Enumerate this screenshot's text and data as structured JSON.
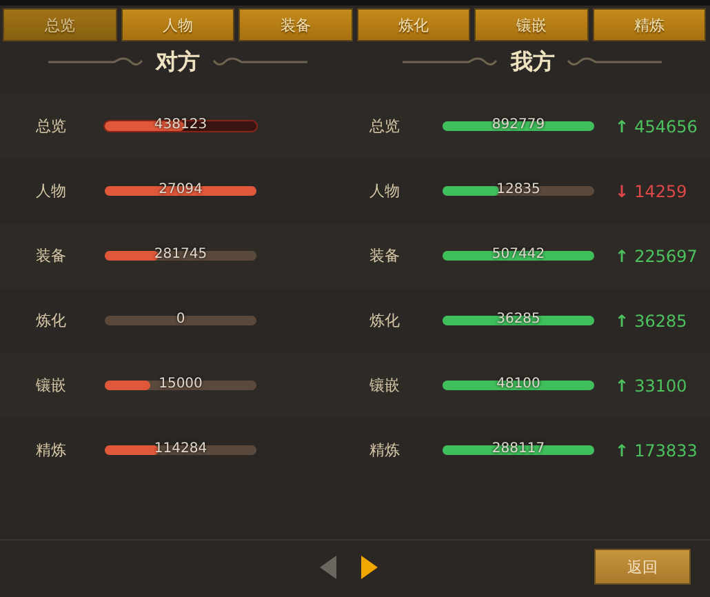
{
  "tabs": [
    {
      "label": "总览",
      "selected": true
    },
    {
      "label": "人物",
      "selected": false
    },
    {
      "label": "装备",
      "selected": false
    },
    {
      "label": "炼化",
      "selected": false
    },
    {
      "label": "镶嵌",
      "selected": false
    },
    {
      "label": "精炼",
      "selected": false
    }
  ],
  "sides": [
    {
      "title": "对方"
    },
    {
      "title": "我方"
    }
  ],
  "rows": [
    {
      "opponent": {
        "label": "总览",
        "value": "438123",
        "level": 0.53,
        "outlined": true
      },
      "mine": {
        "label": "总览",
        "value": "892779",
        "level": 1.0
      },
      "change": {
        "arrow": "↑",
        "value": "454656",
        "color": "#4cc25e"
      }
    },
    {
      "opponent": {
        "label": "人物",
        "value": "27094",
        "level": 1.0,
        "outlined": false
      },
      "mine": {
        "label": "人物",
        "value": "12835",
        "level": 0.37
      },
      "change": {
        "arrow": "↓",
        "value": "14259",
        "color": "#e04848"
      }
    },
    {
      "opponent": {
        "label": "装备",
        "value": "281745",
        "level": 0.35,
        "outlined": false
      },
      "mine": {
        "label": "装备",
        "value": "507442",
        "level": 1.0
      },
      "change": {
        "arrow": "↑",
        "value": "225697",
        "color": "#4cc25e"
      }
    },
    {
      "opponent": {
        "label": "炼化",
        "value": "0",
        "level": 0,
        "outlined": false
      },
      "mine": {
        "label": "炼化",
        "value": "36285",
        "level": 1.0
      },
      "change": {
        "arrow": "↑",
        "value": "36285",
        "color": "#4cc25e"
      }
    },
    {
      "opponent": {
        "label": "镶嵌",
        "value": "15000",
        "level": 0.3,
        "outlined": false
      },
      "mine": {
        "label": "镶嵌",
        "value": "48100",
        "level": 1.0
      },
      "change": {
        "arrow": "↑",
        "value": "33100",
        "color": "#4cc25e"
      }
    },
    {
      "opponent": {
        "label": "精炼",
        "value": "114284",
        "level": 0.35,
        "outlined": false
      },
      "mine": {
        "label": "精炼",
        "value": "288117",
        "level": 1.0
      },
      "change": {
        "arrow": "↑",
        "value": "173833",
        "color": "#4cc25e"
      }
    }
  ],
  "pager": {
    "prev_disabled": true,
    "next_disabled": false
  },
  "back_button": "返回"
}
